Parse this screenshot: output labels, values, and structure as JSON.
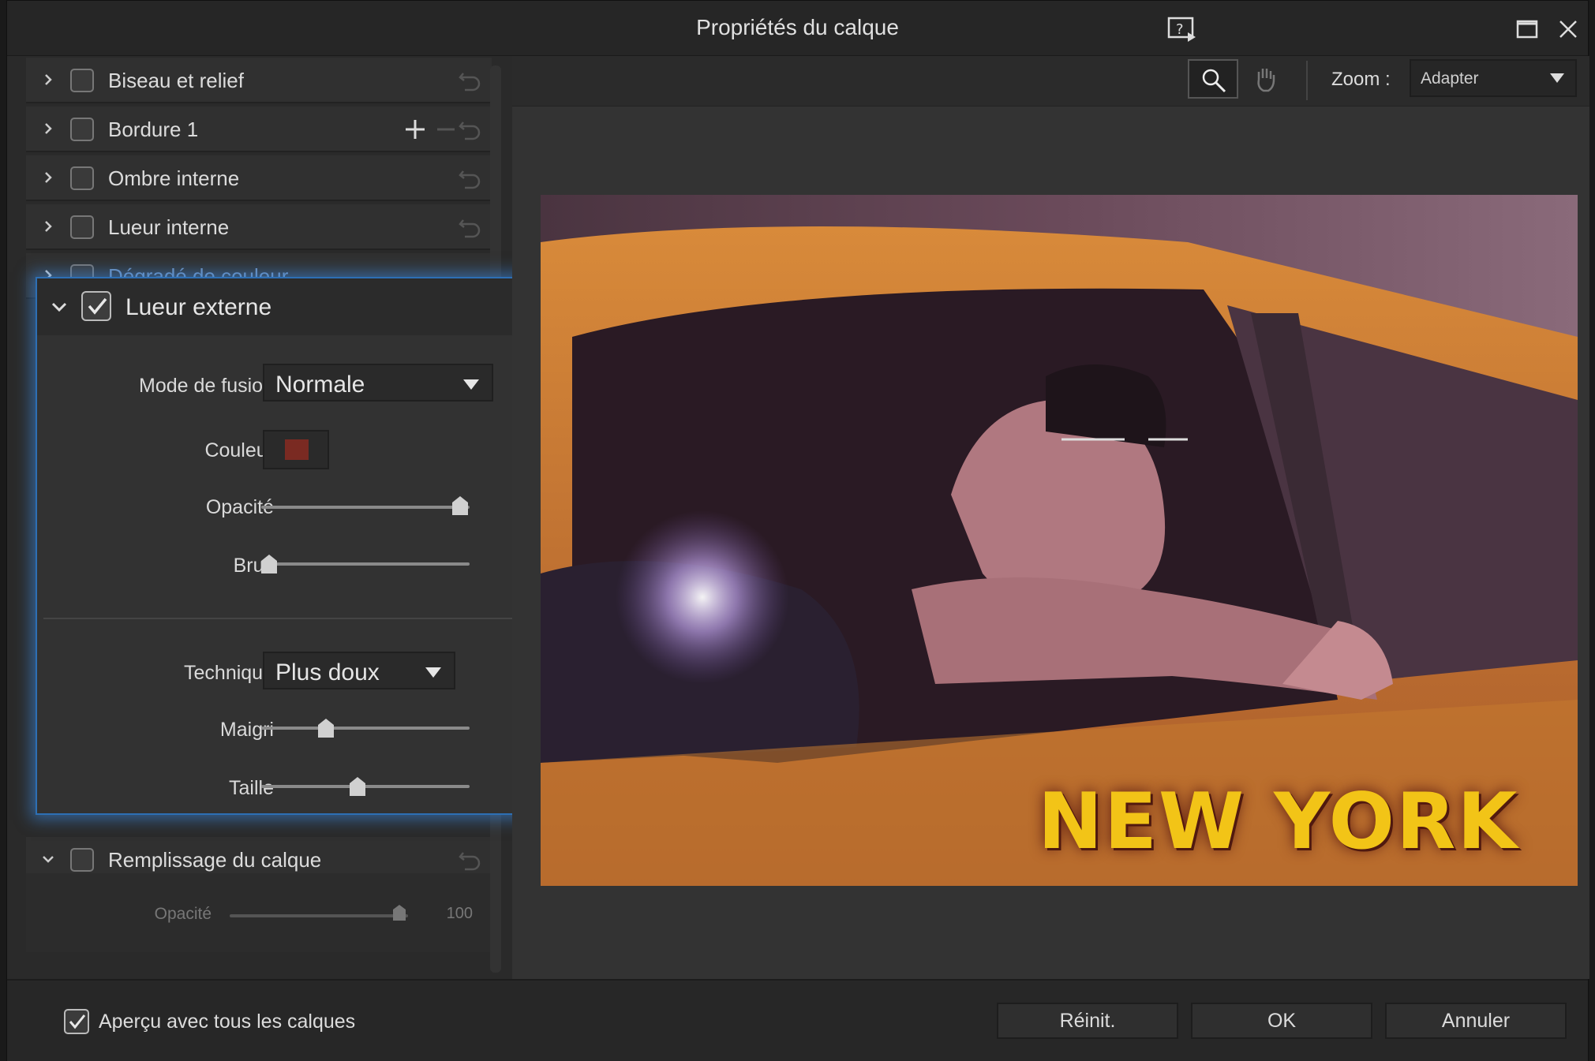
{
  "window": {
    "title": "Propriétés du calque"
  },
  "effects": [
    {
      "label": "Biseau et relief",
      "checked": false
    },
    {
      "label": "Bordure 1",
      "checked": false
    },
    {
      "label": "Ombre interne",
      "checked": false
    },
    {
      "label": "Lueur interne",
      "checked": false
    },
    {
      "label": "Dégradé de couleur",
      "checked": false
    }
  ],
  "outer_glow": {
    "title": "Lueur externe",
    "checked": true,
    "blend_label": "Mode de fusion",
    "blend_value": "Normale",
    "color_label": "Couleur",
    "color": "#7a2a22",
    "opacity_label": "Opacité",
    "opacity_value": "100",
    "noise_label": "Bruit",
    "noise_value": "0",
    "technique_label": "Technique",
    "technique_value": "Plus doux",
    "spread_label": "Maigri",
    "spread_value": "30",
    "size_label": "Taille",
    "size_value": "118"
  },
  "layer_fill": {
    "label": "Remplissage du calque",
    "checked": false,
    "opacity_label": "Opacité",
    "opacity_value": "100"
  },
  "toolbar": {
    "zoom_label": "Zoom :",
    "zoom_value": "Adapter"
  },
  "preview": {
    "caption": "NEW YORK"
  },
  "footer": {
    "preview_all_label": "Aperçu avec tous les calques",
    "preview_all_checked": true,
    "reset_label": "Réinit.",
    "ok_label": "OK",
    "cancel_label": "Annuler"
  },
  "colors": {
    "accent": "#2d6fb4",
    "text_yellow": "#f2c417"
  }
}
